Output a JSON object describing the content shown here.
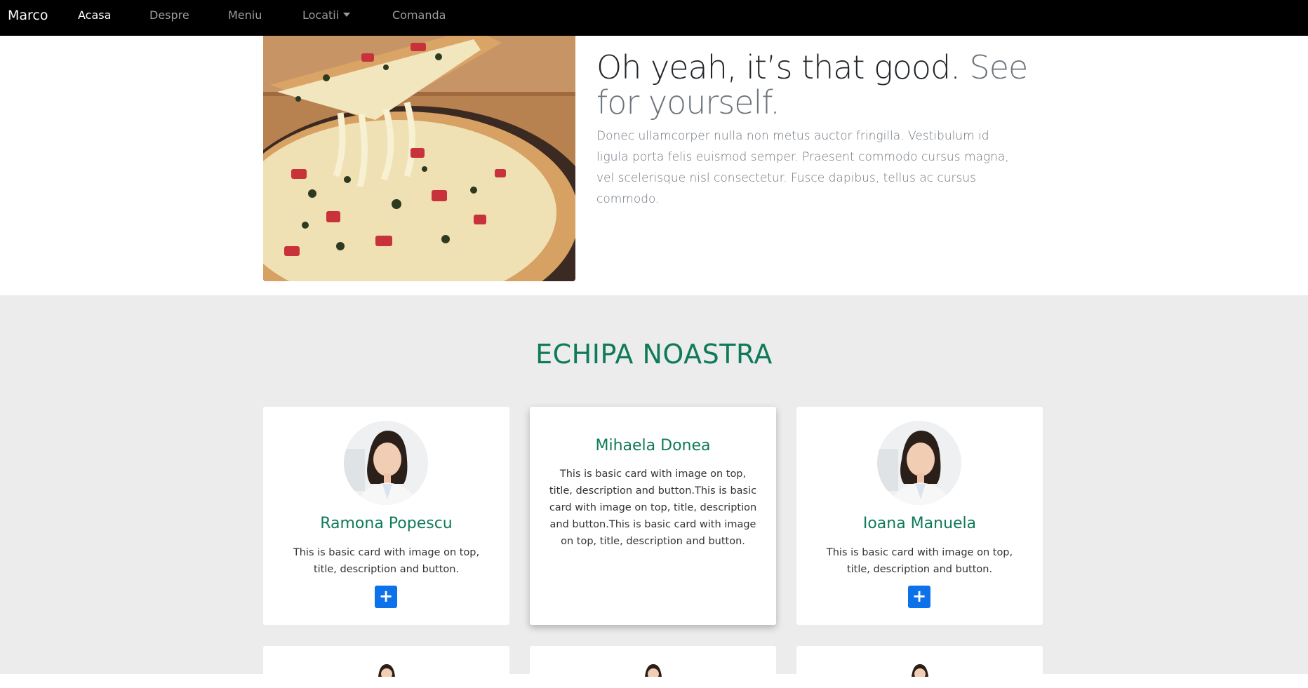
{
  "nav": {
    "brand": "Marco",
    "items": [
      {
        "label": "Acasa"
      },
      {
        "label": "Despre"
      },
      {
        "label": "Meniu"
      },
      {
        "label": "Locatii"
      },
      {
        "label": "Comanda"
      }
    ]
  },
  "feature": {
    "heading_main": "Oh yeah, it’s that good.",
    "heading_muted": "See for yourself.",
    "lead": "Donec ullamcorper nulla non metus auctor fringilla. Vestibulum id ligula porta felis euismod semper. Praesent commodo cursus magna, vel scelerisque nisl consectetur. Fusce dapibus, tellus ac cursus commodo."
  },
  "team": {
    "title": "ECHIPA NOASTRA",
    "cards": [
      {
        "name": "Ramona Popescu",
        "text": "This is basic card with image on top, title, description and button.",
        "button": "+"
      },
      {
        "name": "Mihaela Donea",
        "text": "This is basic card with image on top, title, description and button.This is basic card with image on top, title, description and button.This is basic card with image on top, title, description and button."
      },
      {
        "name": "Ioana Manuela",
        "text": "This is basic card with image on top, title, description and button.",
        "button": "+"
      }
    ]
  },
  "colors": {
    "navbar_bg": "#000000",
    "team_bg": "#ececec",
    "accent_green": "#0f7a5a",
    "button_blue": "#0d72ea"
  }
}
